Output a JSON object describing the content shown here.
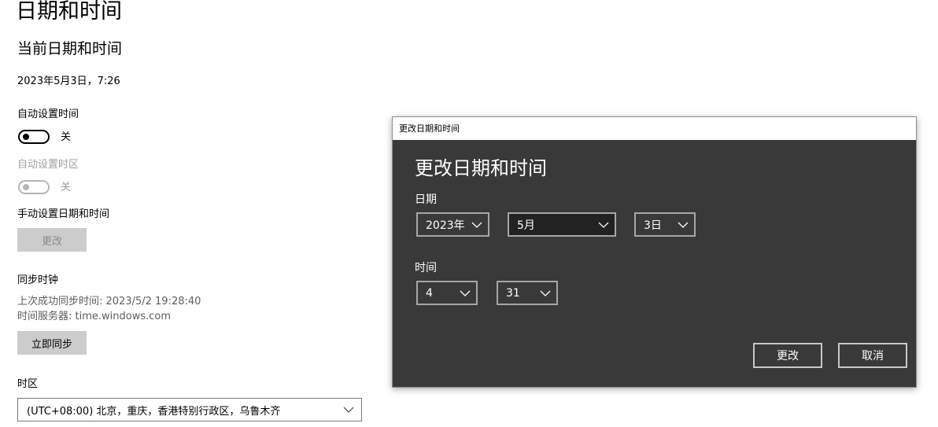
{
  "page": {
    "title": "日期和时间",
    "section_title": "当前日期和时间",
    "current_datetime": "2023年5月3日，7:26"
  },
  "auto_time": {
    "label": "自动设置时间",
    "state_label": "关",
    "enabled": false
  },
  "auto_timezone": {
    "label": "自动设置时区",
    "state_label": "关",
    "enabled": false
  },
  "manual": {
    "label": "手动设置日期和时间",
    "button_label": "更改"
  },
  "sync": {
    "label": "同步时钟",
    "last_sync": "上次成功同步时间: 2023/5/2 19:28:40",
    "server": "时间服务器: time.windows.com",
    "button_label": "立即同步"
  },
  "timezone": {
    "label": "时区",
    "value": "(UTC+08:00) 北京，重庆，香港特别行政区，乌鲁木齐"
  },
  "dialog": {
    "titlebar": "更改日期和时间",
    "heading": "更改日期和时间",
    "date_label": "日期",
    "year": "2023年",
    "month": "5月",
    "day": "3日",
    "time_label": "时间",
    "hour": "4",
    "minute": "31",
    "ok_label": "更改",
    "cancel_label": "取消"
  },
  "icons": {
    "dropdown": "chevron-down-icon",
    "toggle_knob": "toggle-knob-icon"
  },
  "colors": {
    "dialog_bg": "#393939",
    "disabled_text": "#a0a0a0",
    "button_bg": "#cccccc"
  }
}
